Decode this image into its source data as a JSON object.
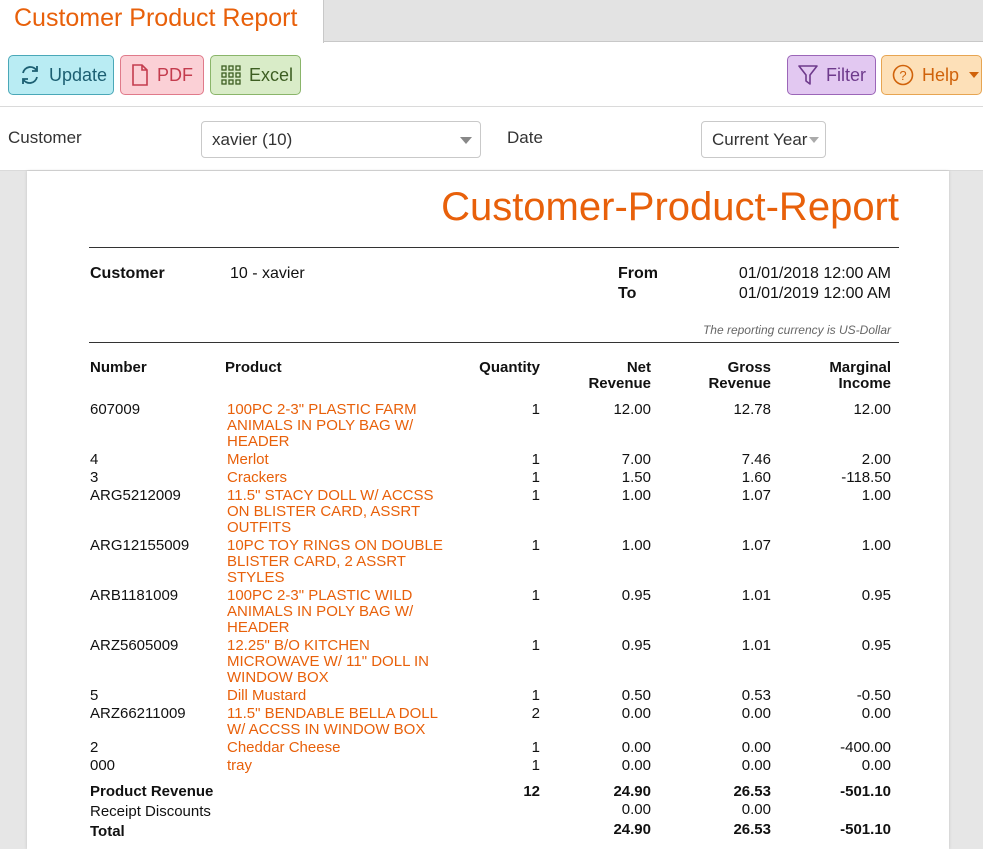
{
  "tab": {
    "title": "Customer Product Report"
  },
  "toolbar": {
    "update": "Update",
    "pdf": "PDF",
    "excel": "Excel",
    "filter": "Filter",
    "help": "Help"
  },
  "filters": {
    "customer_label": "Customer",
    "customer_value": "xavier (10)",
    "date_label": "Date",
    "date_value": "Current Year"
  },
  "report": {
    "title": "Customer-Product-Report",
    "customer_label": "Customer",
    "customer_value": "10 - xavier",
    "from_label": "From",
    "from_value": "01/01/2018 12:00 AM",
    "to_label": "To",
    "to_value": "01/01/2019 12:00 AM",
    "currency_note": "The reporting currency is US-Dollar",
    "columns": {
      "number": "Number",
      "product": "Product",
      "quantity": "Quantity",
      "net1": "Net",
      "net2": "Revenue",
      "gross1": "Gross",
      "gross2": "Revenue",
      "marg1": "Marginal",
      "marg2": "Income"
    },
    "rows": [
      {
        "number": "607009",
        "product": "100PC 2-3\" PLASTIC FARM ANIMALS IN POLY BAG W/ HEADER",
        "qty": "1",
        "net": "12.00",
        "gross": "12.78",
        "marginal": "12.00"
      },
      {
        "number": "4",
        "product": "Merlot",
        "qty": "1",
        "net": "7.00",
        "gross": "7.46",
        "marginal": "2.00"
      },
      {
        "number": "3",
        "product": "Crackers",
        "qty": "1",
        "net": "1.50",
        "gross": "1.60",
        "marginal": "-118.50"
      },
      {
        "number": "ARG5212009",
        "product": "11.5\" STACY DOLL W/ ACCSS ON BLISTER CARD, ASSRT OUTFITS",
        "qty": "1",
        "net": "1.00",
        "gross": "1.07",
        "marginal": "1.00"
      },
      {
        "number": "ARG12155009",
        "product": "10PC TOY RINGS ON DOUBLE BLISTER CARD, 2 ASSRT STYLES",
        "qty": "1",
        "net": "1.00",
        "gross": "1.07",
        "marginal": "1.00"
      },
      {
        "number": "ARB1181009",
        "product": "100PC 2-3\" PLASTIC WILD ANIMALS IN POLY BAG W/ HEADER",
        "qty": "1",
        "net": "0.95",
        "gross": "1.01",
        "marginal": "0.95"
      },
      {
        "number": "ARZ5605009",
        "product": "12.25\" B/O KITCHEN MICROWAVE W/ 11\" DOLL IN WINDOW BOX",
        "qty": "1",
        "net": "0.95",
        "gross": "1.01",
        "marginal": "0.95"
      },
      {
        "number": "5",
        "product": "Dill Mustard",
        "qty": "1",
        "net": "0.50",
        "gross": "0.53",
        "marginal": "-0.50"
      },
      {
        "number": "ARZ66211009",
        "product": "11.5\" BENDABLE BELLA DOLL W/ ACCSS IN WINDOW BOX",
        "qty": "2",
        "net": "0.00",
        "gross": "0.00",
        "marginal": "0.00"
      },
      {
        "number": "2",
        "product": "Cheddar Cheese",
        "qty": "1",
        "net": "0.00",
        "gross": "0.00",
        "marginal": "-400.00"
      },
      {
        "number": "000",
        "product": "tray",
        "qty": "1",
        "net": "0.00",
        "gross": "0.00",
        "marginal": "0.00"
      }
    ],
    "totals": {
      "product_revenue_label": "Product Revenue",
      "product_revenue_qty": "12",
      "product_revenue_net": "24.90",
      "product_revenue_gross": "26.53",
      "product_revenue_marginal": "-501.10",
      "receipt_discounts_label": "Receipt Discounts",
      "receipt_discounts_net": "0.00",
      "receipt_discounts_gross": "0.00",
      "total_label": "Total",
      "total_net": "24.90",
      "total_gross": "26.53",
      "total_marginal": "-501.10"
    }
  }
}
